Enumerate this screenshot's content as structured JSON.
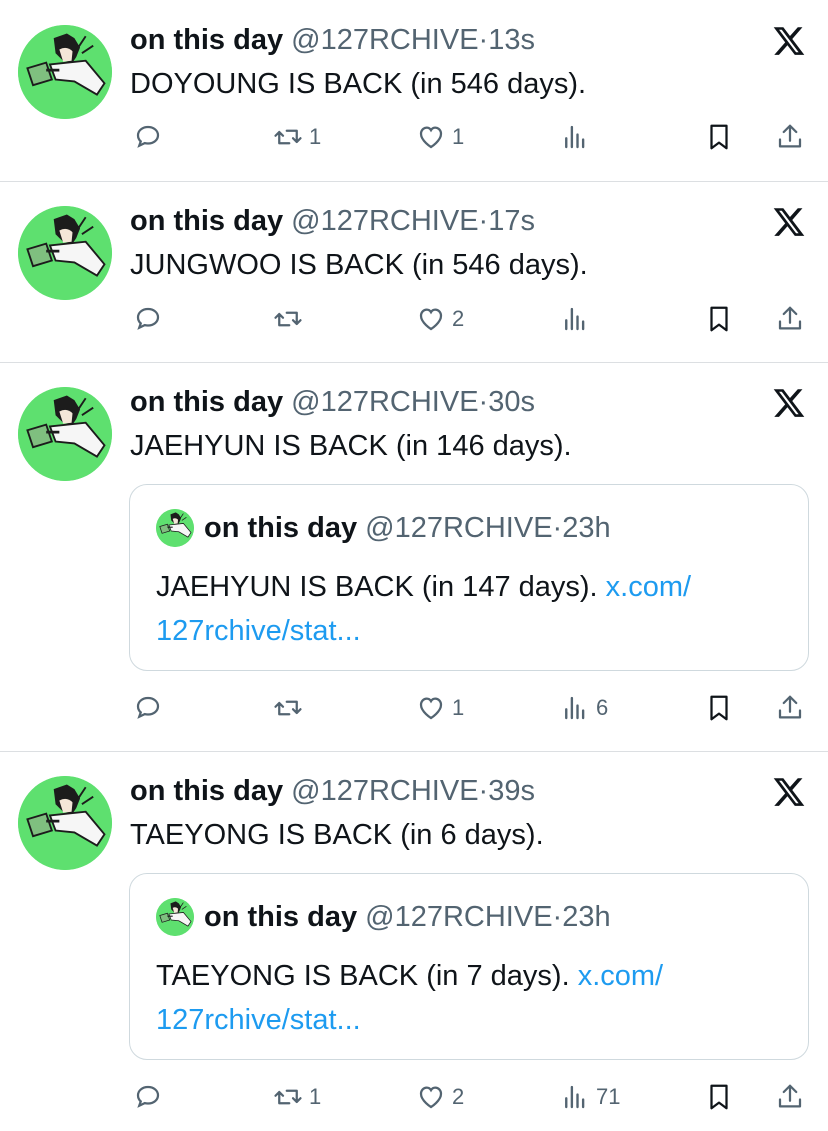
{
  "tweets": [
    {
      "name": "on this day",
      "handle": "@127RCHIVE",
      "dot": "·",
      "time": "13s",
      "text": "DOYOUNG IS BACK (in 546 days).",
      "reply_count": "",
      "retweet_count": "1",
      "like_count": "1",
      "views_count": ""
    },
    {
      "name": "on this day",
      "handle": "@127RCHIVE",
      "dot": "·",
      "time": "17s",
      "text": "JUNGWOO IS BACK (in 546 days).",
      "reply_count": "",
      "retweet_count": "",
      "like_count": "2",
      "views_count": ""
    },
    {
      "name": "on this day",
      "handle": "@127RCHIVE",
      "dot": "·",
      "time": "30s",
      "text": "JAEHYUN IS BACK (in 146 days).",
      "quote": {
        "name": "on this day",
        "handle": "@127RCHIVE",
        "dot": "·",
        "time": "23h",
        "text": "JAEHYUN IS BACK (in 147 days). ",
        "link": "x.com/​127rchive/stat..."
      },
      "reply_count": "",
      "retweet_count": "",
      "like_count": "1",
      "views_count": "6"
    },
    {
      "name": "on this day",
      "handle": "@127RCHIVE",
      "dot": "·",
      "time": "39s",
      "text": "TAEYONG IS BACK (in 6 days).",
      "quote": {
        "name": "on this day",
        "handle": "@127RCHIVE",
        "dot": "·",
        "time": "23h",
        "text": "TAEYONG IS BACK (in 7 days). ",
        "link": "x.com/​127rchive/stat..."
      },
      "reply_count": "",
      "retweet_count": "1",
      "like_count": "2",
      "views_count": "71"
    }
  ],
  "icons": {
    "platform": "x-logo-icon",
    "reply": "reply-icon",
    "retweet": "retweet-icon",
    "like": "heart-icon",
    "views": "views-icon",
    "bookmark": "bookmark-icon",
    "share": "share-icon"
  },
  "colors": {
    "avatar_bg": "#5ee06f",
    "link": "#1d9bf0",
    "muted": "#536471",
    "divider": "#dcdfe2"
  }
}
